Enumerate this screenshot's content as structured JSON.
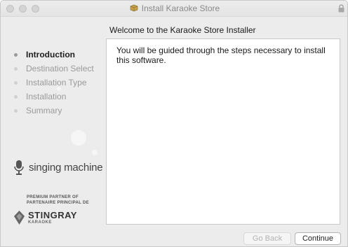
{
  "window": {
    "title": "Install Karaoke Store",
    "title_icon": "package-icon",
    "lock_icon": "lock-icon"
  },
  "heading": "Welcome to the Karaoke Store Installer",
  "sidebar": {
    "steps": [
      {
        "label": "Introduction",
        "active": true
      },
      {
        "label": "Destination Select",
        "active": false
      },
      {
        "label": "Installation Type",
        "active": false
      },
      {
        "label": "Installation",
        "active": false
      },
      {
        "label": "Summary",
        "active": false
      }
    ],
    "brand": {
      "singing_machine": "singing machine",
      "partner_line1": "PREMIUM PARTNER OF",
      "partner_line2": "PARTENAIRE PRINCIPAL DE",
      "stingray_name": "STINGRAY",
      "stingray_sub": "KARAOKE"
    }
  },
  "content": {
    "text": "You will be guided through the steps necessary to install this software."
  },
  "buttons": {
    "back": "Go Back",
    "continue": "Continue"
  }
}
